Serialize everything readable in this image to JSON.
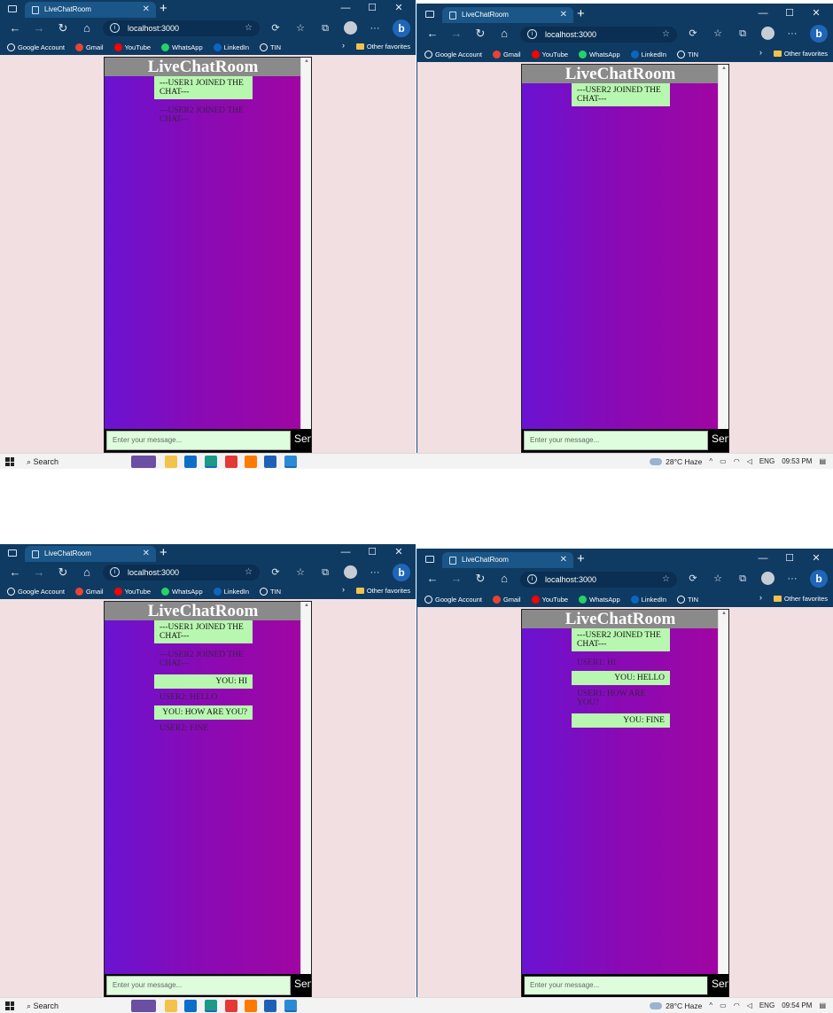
{
  "browser": {
    "tab_title": "LiveChatRoom",
    "url": "localhost:3000",
    "reader_label": "A",
    "favorites": [
      {
        "label": "Google Account",
        "icon": "google-icon",
        "color": "#ffffff"
      },
      {
        "label": "Gmail",
        "icon": "gmail-icon",
        "color": "#ea4335"
      },
      {
        "label": "YouTube",
        "icon": "youtube-icon",
        "color": "#ff0000"
      },
      {
        "label": "WhatsApp",
        "icon": "whatsapp-icon",
        "color": "#25d366"
      },
      {
        "label": "LinkedIn",
        "icon": "linkedin-icon",
        "color": "#0a66c2"
      },
      {
        "label": "TIN",
        "icon": "page-icon",
        "color": "#ffffff"
      }
    ],
    "other_favorites": "Other favorites",
    "bing_label": "b"
  },
  "chat": {
    "title": "LiveChatRoom",
    "input_placeholder": "Enter your message...",
    "send_label": "Send"
  },
  "screens": [
    {
      "windows": [
        {
          "messages": [
            {
              "type": "sys",
              "text": "---USER1 JOINED THE CHAT---"
            },
            {
              "type": "other",
              "text": "---USER2 JOINED THE CHAT---"
            }
          ]
        },
        {
          "messages": [
            {
              "type": "sys",
              "text": "---USER2 JOINED THE CHAT---"
            }
          ]
        }
      ],
      "taskbar": {
        "search": "Search",
        "weather": "28°C Haze",
        "lang": "ENG",
        "time": "09:53 PM"
      }
    },
    {
      "windows": [
        {
          "messages": [
            {
              "type": "sys",
              "text": "---USER1 JOINED THE CHAT---"
            },
            {
              "type": "other",
              "text": "---USER2 JOINED THE CHAT---"
            },
            {
              "type": "me",
              "text": "YOU: HI"
            },
            {
              "type": "other",
              "text": "USER2: HELLO"
            },
            {
              "type": "me",
              "text": "YOU: HOW ARE YOU?"
            },
            {
              "type": "other",
              "text": "USER2: FINE"
            }
          ]
        },
        {
          "messages": [
            {
              "type": "sys",
              "text": "---USER2 JOINED THE CHAT---"
            },
            {
              "type": "other",
              "text": "USER1: HI"
            },
            {
              "type": "me",
              "text": "YOU: HELLO"
            },
            {
              "type": "other",
              "text": "USER1: HOW ARE YOU?"
            },
            {
              "type": "me",
              "text": "YOU: FINE"
            }
          ]
        }
      ],
      "taskbar": {
        "search": "Search",
        "weather": "28°C Haze",
        "lang": "ENG",
        "time": "09:54 PM"
      }
    }
  ]
}
